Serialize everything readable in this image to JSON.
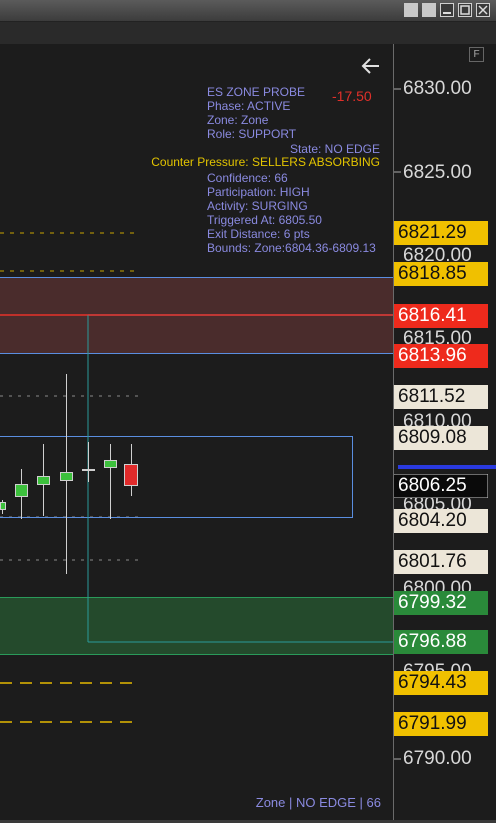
{
  "colors": {
    "supply": "#4a2a2a",
    "supply_border": "#5a8ee0",
    "demand": "#244a2a",
    "demand_border": "#2a9a5a",
    "info_text": "#8a8ae0",
    "counter_pressure": "#e3c400",
    "pnl_negative": "#e0302a"
  },
  "window": {
    "controls": [
      "minimize-icon",
      "maximize-icon",
      "close-icon"
    ]
  },
  "axis": {
    "f_button": "F",
    "price_labels": [
      "6830.00",
      "6825.00",
      "6820.00",
      "6815.00",
      "6810.00",
      "6805.00",
      "6800.00",
      "6795.00",
      "6790.00"
    ]
  },
  "price_tags": [
    {
      "value": "6821.29",
      "kind": "yellow"
    },
    {
      "value": "6818.85",
      "kind": "yellow"
    },
    {
      "value": "6816.41",
      "kind": "red"
    },
    {
      "value": "6813.96",
      "kind": "red"
    },
    {
      "value": "6811.52",
      "kind": "white"
    },
    {
      "value": "6809.08",
      "kind": "white"
    },
    {
      "value": "6806.25",
      "kind": "black"
    },
    {
      "value": "6804.20",
      "kind": "white"
    },
    {
      "value": "6801.76",
      "kind": "white"
    },
    {
      "value": "6799.32",
      "kind": "green"
    },
    {
      "value": "6796.88",
      "kind": "green"
    },
    {
      "value": "6794.43",
      "kind": "yellow"
    },
    {
      "value": "6791.99",
      "kind": "yellow"
    }
  ],
  "probe": {
    "title": "ES ZONE PROBE",
    "pnl": "-17.50",
    "phase": "Phase: ACTIVE",
    "zone": "Zone: Zone",
    "role": "Role: SUPPORT",
    "state": "State: NO EDGE",
    "counter_pressure": "Counter Pressure: SELLERS ABSORBING",
    "confidence": "Confidence: 66",
    "participation": "Participation: HIGH",
    "activity": "Activity: SURGING",
    "triggered_at": "Triggered At: 6805.50",
    "exit_distance": "Exit Distance: 6 pts",
    "bounds": "Bounds: Zone:6804.36-6809.13"
  },
  "status": "Zone | NO EDGE | 66",
  "back_arrow": "arrow-left-icon"
}
